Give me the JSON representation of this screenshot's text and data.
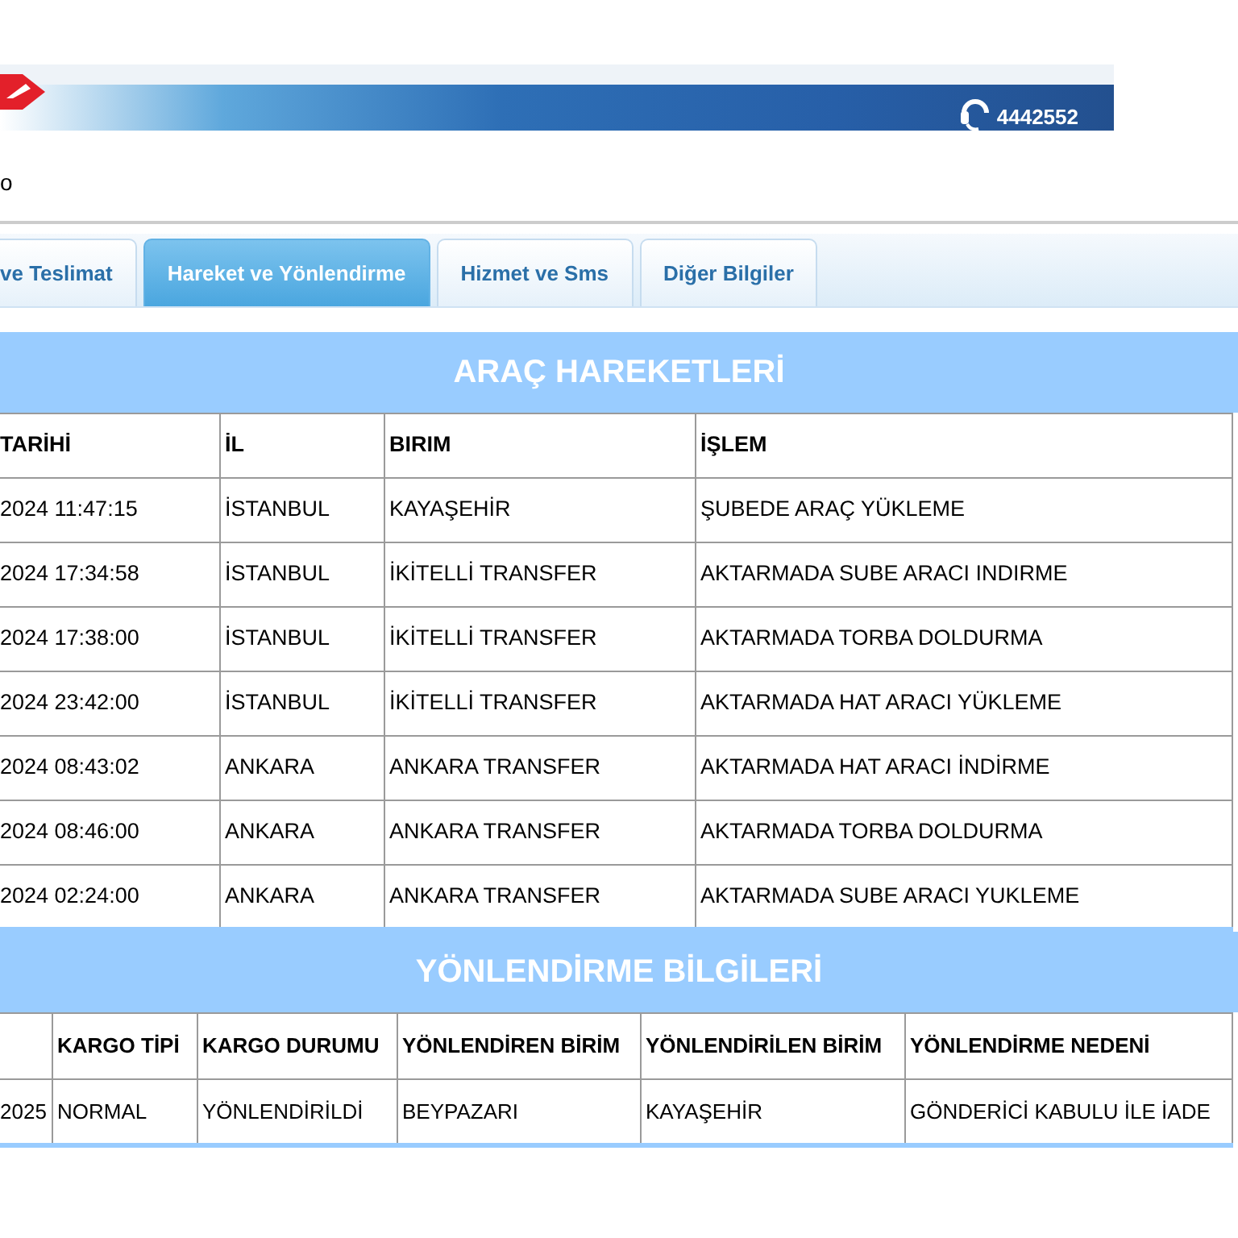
{
  "banner": {
    "phone": "4442552"
  },
  "page_label": "o",
  "tabs": [
    {
      "label": "ve Teslimat",
      "selected": false
    },
    {
      "label": "Hareket ve Yönlendirme",
      "selected": true
    },
    {
      "label": "Hizmet ve Sms",
      "selected": false
    },
    {
      "label": "Diğer Bilgiler",
      "selected": false
    }
  ],
  "vehicle_movements": {
    "title": "ARAÇ HAREKETLERİ",
    "columns": [
      "TARİHİ",
      "İL",
      "BIRIM",
      "İŞLEM"
    ],
    "rows": [
      [
        "2024 11:47:15",
        "İSTANBUL",
        "KAYAŞEHİR",
        "ŞUBEDE ARAÇ YÜKLEME"
      ],
      [
        "2024 17:34:58",
        "İSTANBUL",
        "İKİTELLİ TRANSFER",
        "AKTARMADA SUBE ARACI INDIRME"
      ],
      [
        "2024 17:38:00",
        "İSTANBUL",
        "İKİTELLİ TRANSFER",
        "AKTARMADA TORBA DOLDURMA"
      ],
      [
        "2024 23:42:00",
        "İSTANBUL",
        "İKİTELLİ TRANSFER",
        "AKTARMADA HAT ARACI YÜKLEME"
      ],
      [
        "2024 08:43:02",
        "ANKARA",
        "ANKARA TRANSFER",
        "AKTARMADA HAT ARACI İNDİRME"
      ],
      [
        "2024 08:46:00",
        "ANKARA",
        "ANKARA TRANSFER",
        "AKTARMADA TORBA DOLDURMA"
      ],
      [
        "2024 02:24:00",
        "ANKARA",
        "ANKARA TRANSFER",
        "AKTARMADA SUBE ARACI YUKLEME"
      ]
    ]
  },
  "routing_info": {
    "title": "YÖNLENDİRME BİLGİLERİ",
    "columns": [
      "",
      "KARGO TİPİ",
      "KARGO DURUMU",
      "YÖNLENDİREN BİRİM",
      "YÖNLENDİRİLEN BİRİM",
      "YÖNLENDİRME NEDENİ"
    ],
    "rows": [
      [
        "2025",
        "NORMAL",
        "YÖNLENDİRİLDİ",
        "BEYPAZARI",
        "KAYAŞEHİR",
        "GÖNDERİCİ KABULU İLE İADE"
      ]
    ]
  }
}
